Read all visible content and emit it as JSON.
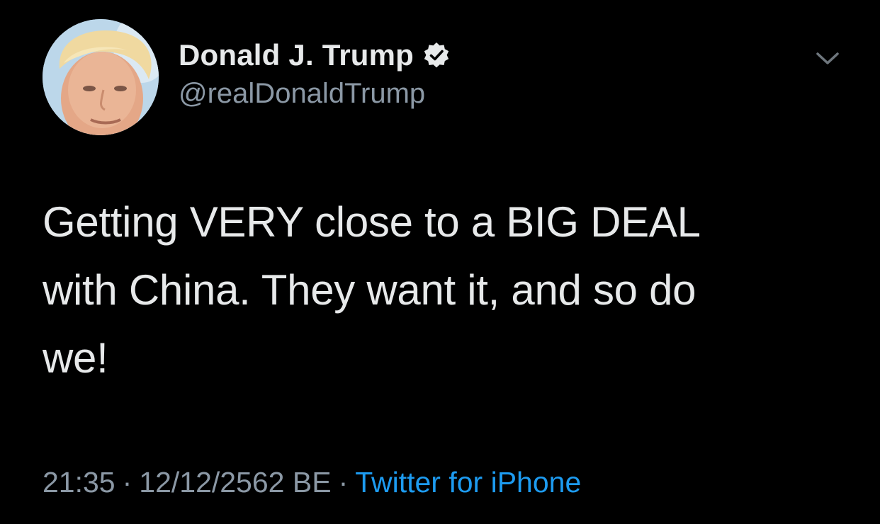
{
  "author": {
    "display_name": "Donald J. Trump",
    "handle": "@realDonaldTrump",
    "verified_icon": "verified-badge-icon",
    "avatar": "profile-photo"
  },
  "menu": {
    "icon": "chevron-down-icon"
  },
  "tweet": {
    "text_lines": [
      "Getting VERY close to a BIG DEAL",
      "with China. They want it, and so do",
      "we!"
    ]
  },
  "meta": {
    "time": "21:35",
    "separator": "·",
    "date": "12/12/2562 BE",
    "source": "Twitter for iPhone"
  },
  "colors": {
    "background": "#000000",
    "primary_text": "#e7e9ea",
    "secondary_text": "#8b98a5",
    "link": "#1d9bf0"
  }
}
